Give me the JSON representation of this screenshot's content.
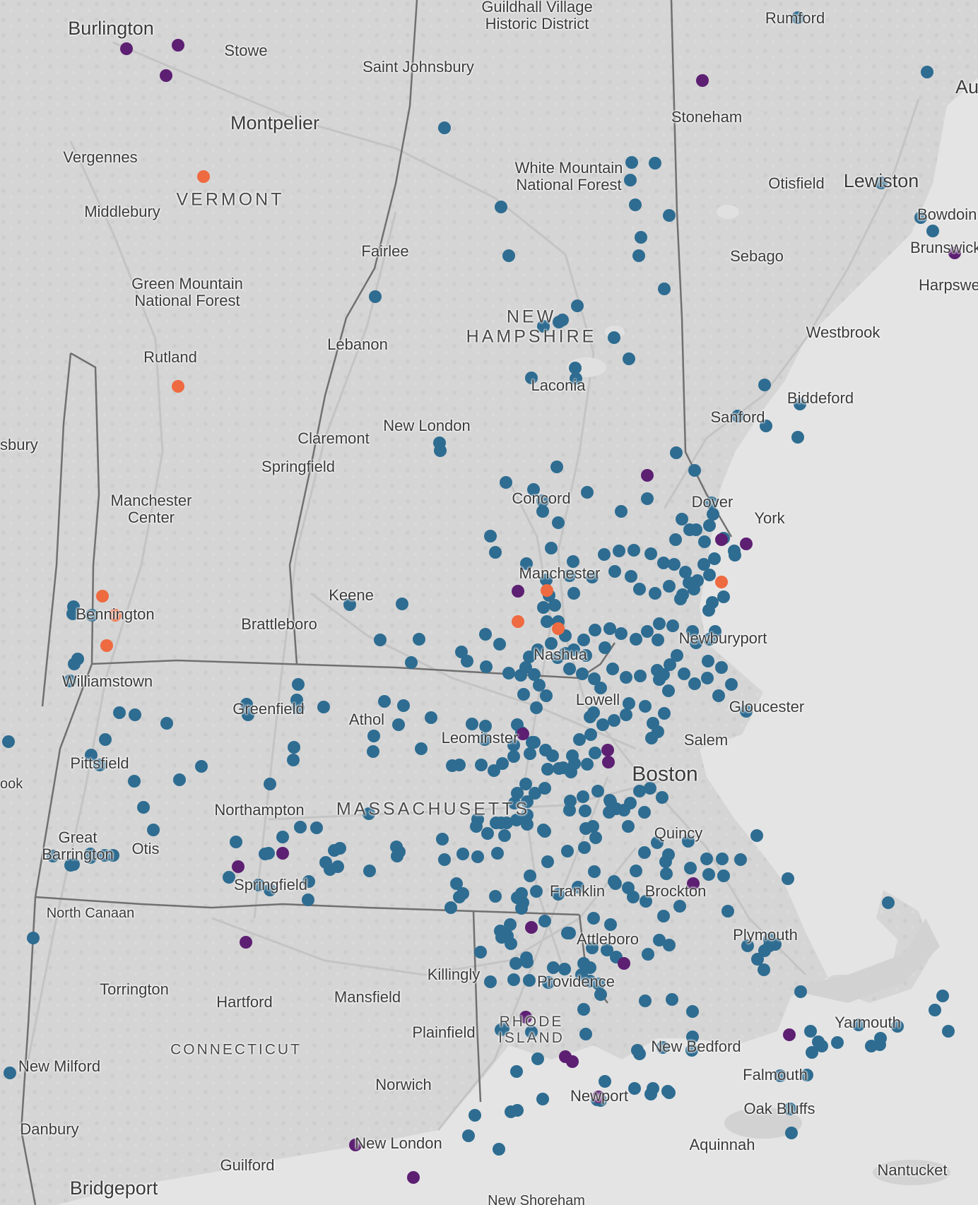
{
  "colors": {
    "water": "#e4e4e4",
    "land": "#d6d6d6",
    "border": "#6f6f6f",
    "road": "#c2c2c2",
    "marker_default": "#2e6c91",
    "marker_alt": "#5c1f72",
    "marker_highlight": "#ee6a40"
  },
  "map": {
    "labels": {
      "guildhall": "Guildhall Village\nHistoric District",
      "rumford": "Rumford",
      "au": "Au",
      "burlington": "Burlington",
      "stowe": "Stowe",
      "saint_johnsbury": "Saint Johnsbury",
      "stoneham": "Stoneham",
      "montpelier": "Montpelier",
      "vergennes": "Vergennes",
      "white_mountain": "White Mountain\nNational Forest",
      "otisfield": "Otisfield",
      "lewiston": "Lewiston",
      "bowdoin": "Bowdoin",
      "vermont": "VERMONT",
      "middlebury": "Middlebury",
      "brunswick": "Brunswick",
      "fairlee": "Fairlee",
      "sebago": "Sebago",
      "green_mountain": "Green Mountain\nNational Forest",
      "harpswell": "Harpswell",
      "new_hampshire": "NEW\nHAMPSHIRE",
      "lebanon": "Lebanon",
      "westbrook": "Westbrook",
      "rutland": "Rutland",
      "laconia": "Laconia",
      "biddeford": "Biddeford",
      "sanford": "Sanford",
      "new_london_nh": "New London",
      "claremont": "Claremont",
      "sbury": "sbury",
      "springfield_vt": "Springfield",
      "concord": "Concord",
      "manchester_center": "Manchester\nCenter",
      "dover": "Dover",
      "york": "York",
      "manchester": "Manchester",
      "keene": "Keene",
      "bennington": "Bennington",
      "brattleboro": "Brattleboro",
      "newburyport": "Newburyport",
      "nashua": "Nashua",
      "williamstown": "Williamstown",
      "lowell": "Lowell",
      "greenfield": "Greenfield",
      "gloucester": "Gloucester",
      "athol": "Athol",
      "leominster": "Leominster",
      "salem": "Salem",
      "pittsfield": "Pittsfield",
      "boston": "Boston",
      "ook": "ook",
      "northampton": "Northampton",
      "massachusetts": "MASSACHUSETTS",
      "quincy": "Quincy",
      "great_barrington": "Great\nBarrington",
      "otis": "Otis",
      "springfield_ma": "Springfield",
      "franklin": "Franklin",
      "brockton": "Brockton",
      "north_canaan": "North Canaan",
      "plymouth": "Plymouth",
      "attleboro": "Attleboro",
      "killingly": "Killingly",
      "providence": "Providence",
      "torrington": "Torrington",
      "hartford": "Hartford",
      "mansfield": "Mansfield",
      "yarmouth": "Yarmouth",
      "plainfield": "Plainfield",
      "rhode_island": "RHODE\nISLAND",
      "connecticut": "CONNECTICUT",
      "new_bedford": "New Bedford",
      "new_milford": "New Milford",
      "falmouth": "Falmouth",
      "norwich": "Norwich",
      "newport": "Newport",
      "oak_bluffs": "Oak Bluffs",
      "danbury": "Danbury",
      "new_london_ct": "New London",
      "aquinnah": "Aquinnah",
      "guilford": "Guilford",
      "nantucket": "Nantucket",
      "bridgeport": "Bridgeport",
      "new_shoreham": "New Shoreham"
    }
  }
}
